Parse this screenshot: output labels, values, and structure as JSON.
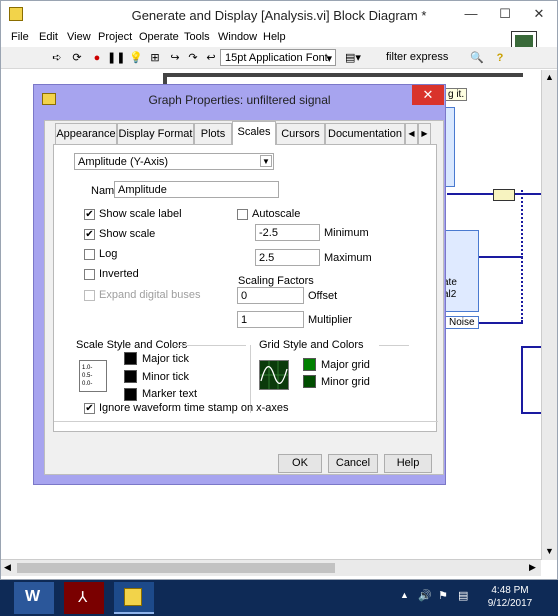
{
  "window": {
    "title": "Generate and Display [Analysis.vi] Block Diagram *",
    "minimize_glyph": "—",
    "maximize_glyph": "☐",
    "close_glyph": "✕"
  },
  "menu": [
    "File",
    "Edit",
    "View",
    "Project",
    "Operate",
    "Tools",
    "Window",
    "Help"
  ],
  "toolbar": {
    "font_dropdown": "15pt Application Font",
    "search_placeholder": "filter express",
    "icons": [
      "run-arrow-icon",
      "run-continuously-icon",
      "abort-icon",
      "pause-icon",
      "highlight-execution-icon",
      "retain-wire-values-icon",
      "step-into-icon",
      "step-over-icon",
      "step-out-icon",
      "align-icon",
      "search-icon",
      "help-icon"
    ]
  },
  "diagram": {
    "tip_text": "g it.",
    "node_text_1": "ate",
    "node_text_2": "al2",
    "node_text_3": "Noise"
  },
  "dialog": {
    "title": "Graph Properties: unfiltered signal",
    "close_glyph": "✕",
    "tabs": [
      "Appearance",
      "Display Format",
      "Plots",
      "Scales",
      "Cursors",
      "Documentation"
    ],
    "active_tab": "Scales",
    "axis_select": "Amplitude (Y-Axis)",
    "name_label": "Name",
    "name_value": "Amplitude",
    "show_scale_label": {
      "label": "Show scale label",
      "checked": true
    },
    "show_scale": {
      "label": "Show scale",
      "checked": true
    },
    "log": {
      "label": "Log",
      "checked": false
    },
    "inverted": {
      "label": "Inverted",
      "checked": false
    },
    "expand_digital": {
      "label": "Expand digital buses",
      "checked": false,
      "disabled": true
    },
    "autoscale": {
      "label": "Autoscale",
      "checked": false
    },
    "minimum": {
      "value": "-2.5",
      "label": "Minimum"
    },
    "maximum": {
      "value": "2.5",
      "label": "Maximum"
    },
    "scaling_factors_label": "Scaling Factors",
    "offset": {
      "value": "0",
      "label": "Offset"
    },
    "multiplier": {
      "value": "1",
      "label": "Multiplier"
    },
    "scale_style_group": "Scale Style and Colors",
    "scale_style_preview": [
      "1.0-",
      "0.5-",
      "0.0-"
    ],
    "major_tick": "Major tick",
    "minor_tick": "Minor tick",
    "marker_text": "Marker text",
    "grid_style_group": "Grid Style and Colors",
    "major_grid": "Major grid",
    "minor_grid": "Minor grid",
    "ignore_timestamp": {
      "label": "Ignore waveform time stamp on x-axes",
      "checked": true
    },
    "ok": "OK",
    "cancel": "Cancel",
    "help": "Help",
    "colors": {
      "tick": "#000000",
      "major_grid": "#008000",
      "minor_grid": "#004d00"
    }
  },
  "taskbar": {
    "time": "4:48 PM",
    "date": "9/12/2017",
    "apps": [
      "word-app-icon",
      "acrobat-app-icon",
      "labview-app-icon"
    ]
  }
}
